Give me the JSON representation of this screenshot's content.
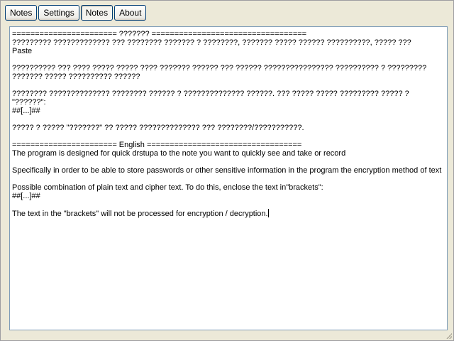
{
  "toolbar": {
    "tabs": [
      {
        "label": "Notes"
      },
      {
        "label": "Settings"
      },
      {
        "label": "Notes"
      },
      {
        "label": "About"
      }
    ]
  },
  "editor": {
    "lines": [
      "======================= ??????? ==================================",
      "????????? ????????????? ??? ???????? ??????? ? ????????, ??????? ????? ?????? ??????????, ????? ???",
      "Paste",
      "",
      "?????????? ??? ???? ????? ????? ???? ??????? ?????? ??? ?????? ???????????????? ?????????? ? ?????????",
      "??????? ????? ?????????? ??????",
      "",
      "???????? ?????????????? ???????? ?????? ? ?????????????? ??????. ??? ????? ????? ????????? ????? ?",
      "\"??????\":",
      "##[...]##",
      "",
      "????? ? ????? \"???????\" ?? ????? ?????????????? ??? ????????/???????????.",
      "",
      "======================= English ==================================",
      "The program is designed for quick drstupa to the note you want to quickly see and take or record",
      "",
      "Specifically in order to be able to store passwords or other sensitive information in the program the encryption method of text",
      "",
      "Possible combination of plain text and cipher text. To do this, enclose the text in\"brackets\":",
      "##[...]##",
      "",
      "The text in the \"brackets\" will not be processed for encryption / decryption."
    ]
  }
}
